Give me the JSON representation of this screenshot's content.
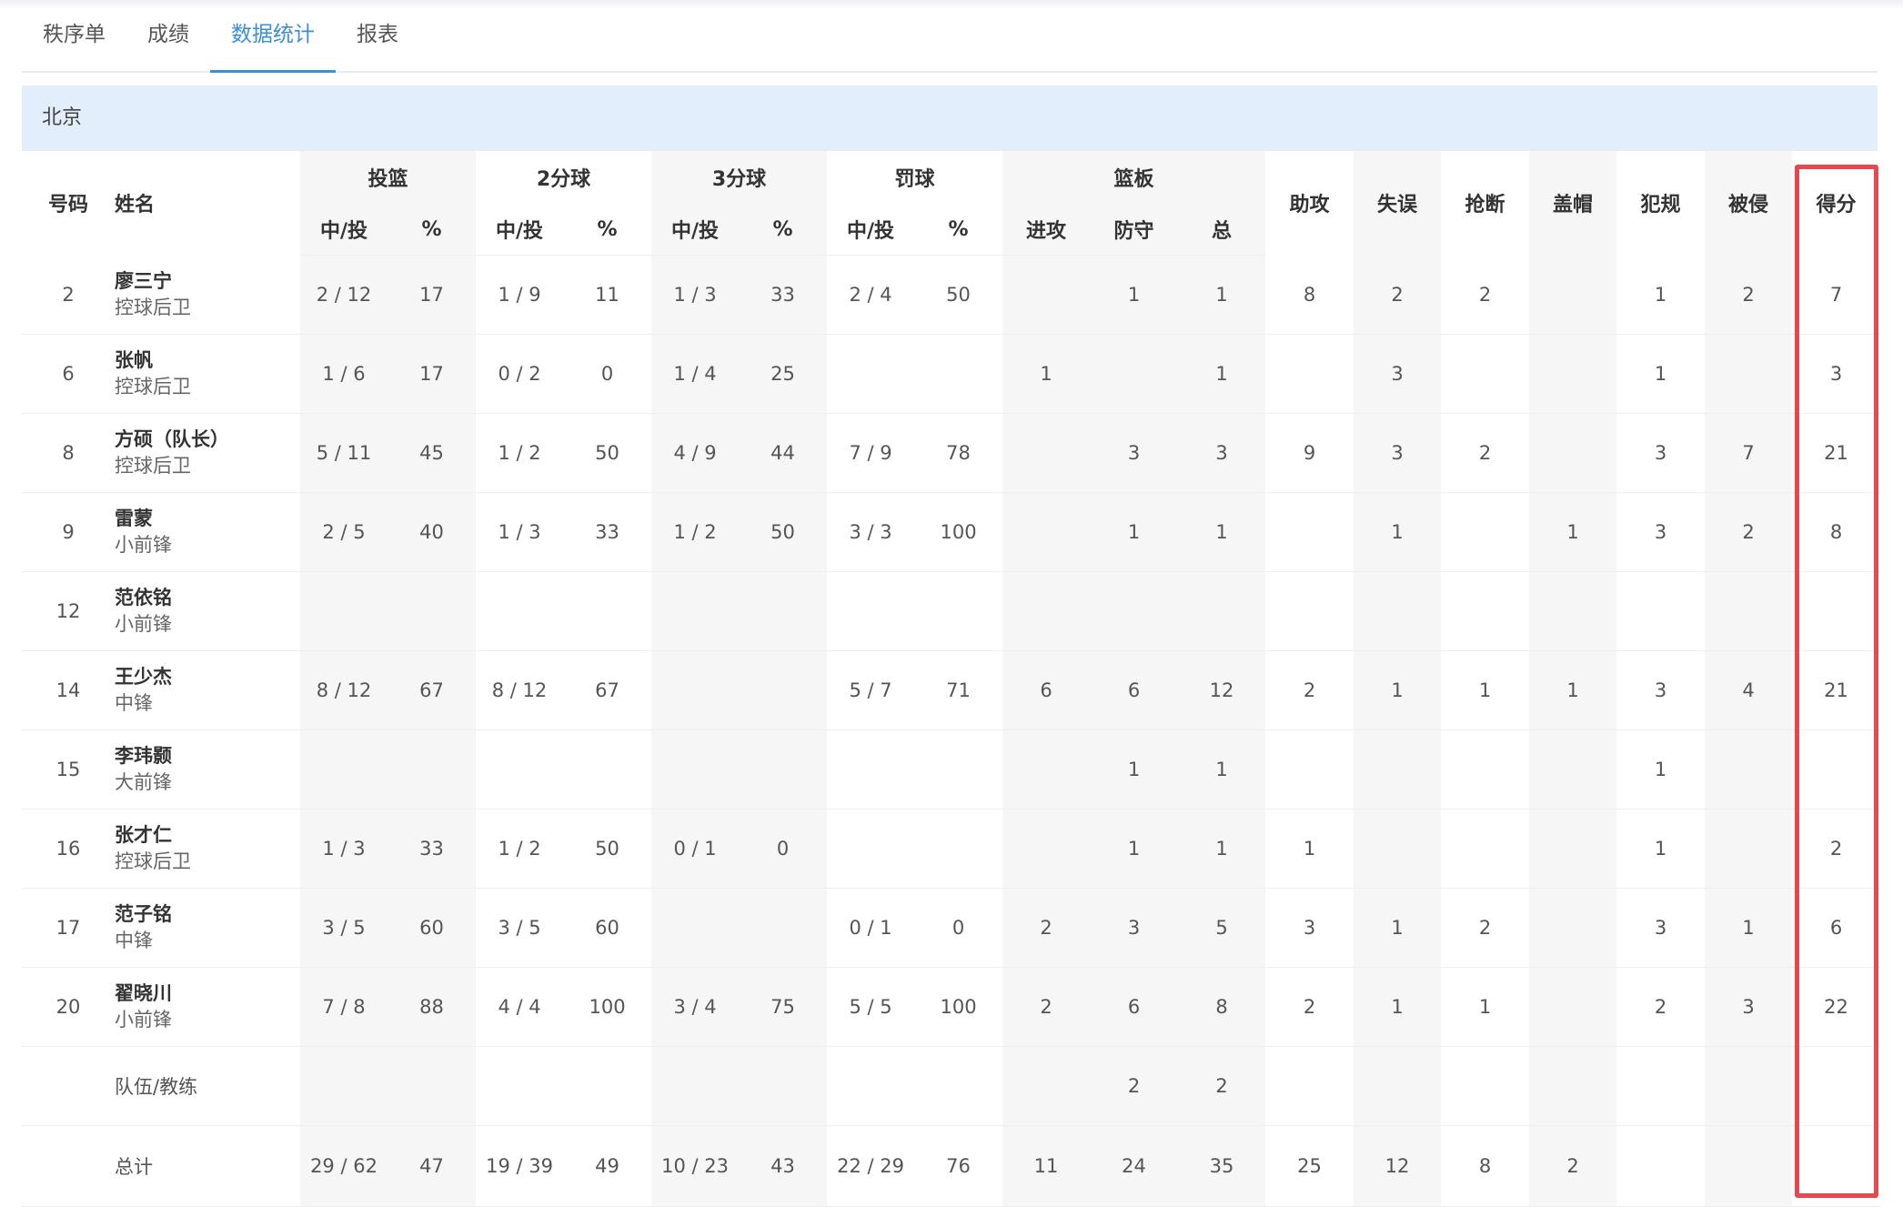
{
  "tabs": [
    {
      "label": "秩序单",
      "active": false
    },
    {
      "label": "成绩",
      "active": false
    },
    {
      "label": "数据统计",
      "active": true
    },
    {
      "label": "报表",
      "active": false
    }
  ],
  "team": "北京",
  "headers": {
    "number": "号码",
    "name": "姓名",
    "groups": [
      "投篮",
      "2分球",
      "3分球",
      "罚球",
      "篮板"
    ],
    "made_attempted": "中/投",
    "percent": "%",
    "rebounds": [
      "进攻",
      "防守",
      "总"
    ],
    "singles": [
      "助攻",
      "失误",
      "抢断",
      "盖帽",
      "犯规",
      "被侵",
      "得分"
    ]
  },
  "rows": [
    {
      "no": "2",
      "name": "廖三宁",
      "pos": "控球后卫",
      "fg": "2 / 12",
      "fgp": "17",
      "p2": "1 / 9",
      "p2p": "11",
      "p3": "1 / 3",
      "p3p": "33",
      "ft": "2 / 4",
      "ftp": "50",
      "oreb": "",
      "dreb": "1",
      "treb": "1",
      "ast": "8",
      "tov": "2",
      "stl": "2",
      "blk": "",
      "pf": "1",
      "fd": "2",
      "pts": "7"
    },
    {
      "no": "6",
      "name": "张帆",
      "pos": "控球后卫",
      "fg": "1 / 6",
      "fgp": "17",
      "p2": "0 / 2",
      "p2p": "0",
      "p3": "1 / 4",
      "p3p": "25",
      "ft": "",
      "ftp": "",
      "oreb": "1",
      "dreb": "",
      "treb": "1",
      "ast": "",
      "tov": "3",
      "stl": "",
      "blk": "",
      "pf": "1",
      "fd": "",
      "pts": "3"
    },
    {
      "no": "8",
      "name": "方硕（队长）",
      "pos": "控球后卫",
      "fg": "5 / 11",
      "fgp": "45",
      "p2": "1 / 2",
      "p2p": "50",
      "p3": "4 / 9",
      "p3p": "44",
      "ft": "7 / 9",
      "ftp": "78",
      "oreb": "",
      "dreb": "3",
      "treb": "3",
      "ast": "9",
      "tov": "3",
      "stl": "2",
      "blk": "",
      "pf": "3",
      "fd": "7",
      "pts": "21"
    },
    {
      "no": "9",
      "name": "雷蒙",
      "pos": "小前锋",
      "fg": "2 / 5",
      "fgp": "40",
      "p2": "1 / 3",
      "p2p": "33",
      "p3": "1 / 2",
      "p3p": "50",
      "ft": "3 / 3",
      "ftp": "100",
      "oreb": "",
      "dreb": "1",
      "treb": "1",
      "ast": "",
      "tov": "1",
      "stl": "",
      "blk": "1",
      "pf": "3",
      "fd": "2",
      "pts": "8"
    },
    {
      "no": "12",
      "name": "范依铭",
      "pos": "小前锋",
      "fg": "",
      "fgp": "",
      "p2": "",
      "p2p": "",
      "p3": "",
      "p3p": "",
      "ft": "",
      "ftp": "",
      "oreb": "",
      "dreb": "",
      "treb": "",
      "ast": "",
      "tov": "",
      "stl": "",
      "blk": "",
      "pf": "",
      "fd": "",
      "pts": ""
    },
    {
      "no": "14",
      "name": "王少杰",
      "pos": "中锋",
      "fg": "8 / 12",
      "fgp": "67",
      "p2": "8 / 12",
      "p2p": "67",
      "p3": "",
      "p3p": "",
      "ft": "5 / 7",
      "ftp": "71",
      "oreb": "6",
      "dreb": "6",
      "treb": "12",
      "ast": "2",
      "tov": "1",
      "stl": "1",
      "blk": "1",
      "pf": "3",
      "fd": "4",
      "pts": "21"
    },
    {
      "no": "15",
      "name": "李玮颢",
      "pos": "大前锋",
      "fg": "",
      "fgp": "",
      "p2": "",
      "p2p": "",
      "p3": "",
      "p3p": "",
      "ft": "",
      "ftp": "",
      "oreb": "",
      "dreb": "1",
      "treb": "1",
      "ast": "",
      "tov": "",
      "stl": "",
      "blk": "",
      "pf": "1",
      "fd": "",
      "pts": ""
    },
    {
      "no": "16",
      "name": "张才仁",
      "pos": "控球后卫",
      "fg": "1 / 3",
      "fgp": "33",
      "p2": "1 / 2",
      "p2p": "50",
      "p3": "0 / 1",
      "p3p": "0",
      "ft": "",
      "ftp": "",
      "oreb": "",
      "dreb": "1",
      "treb": "1",
      "ast": "1",
      "tov": "",
      "stl": "",
      "blk": "",
      "pf": "1",
      "fd": "",
      "pts": "2"
    },
    {
      "no": "17",
      "name": "范子铭",
      "pos": "中锋",
      "fg": "3 / 5",
      "fgp": "60",
      "p2": "3 / 5",
      "p2p": "60",
      "p3": "",
      "p3p": "",
      "ft": "0 / 1",
      "ftp": "0",
      "oreb": "2",
      "dreb": "3",
      "treb": "5",
      "ast": "3",
      "tov": "1",
      "stl": "2",
      "blk": "",
      "pf": "3",
      "fd": "1",
      "pts": "6"
    },
    {
      "no": "20",
      "name": "翟晓川",
      "pos": "小前锋",
      "fg": "7 / 8",
      "fgp": "88",
      "p2": "4 / 4",
      "p2p": "100",
      "p3": "3 / 4",
      "p3p": "75",
      "ft": "5 / 5",
      "ftp": "100",
      "oreb": "2",
      "dreb": "6",
      "treb": "8",
      "ast": "2",
      "tov": "1",
      "stl": "1",
      "blk": "",
      "pf": "2",
      "fd": "3",
      "pts": "22"
    }
  ],
  "team_row": {
    "label": "队伍/教练",
    "dreb": "2",
    "treb": "2"
  },
  "total_row": {
    "label": "总计",
    "fg": "29 / 62",
    "fgp": "47",
    "p2": "19 / 39",
    "p2p": "49",
    "p3": "10 / 23",
    "p3p": "43",
    "ft": "22 / 29",
    "ftp": "76",
    "oreb": "11",
    "dreb": "24",
    "treb": "35",
    "ast": "25",
    "tov": "12",
    "stl": "8",
    "blk": "2",
    "pf": "",
    "fd": "",
    "pts": ""
  },
  "highlight_color": "#e8474d",
  "accent_color": "#3b8fd6"
}
